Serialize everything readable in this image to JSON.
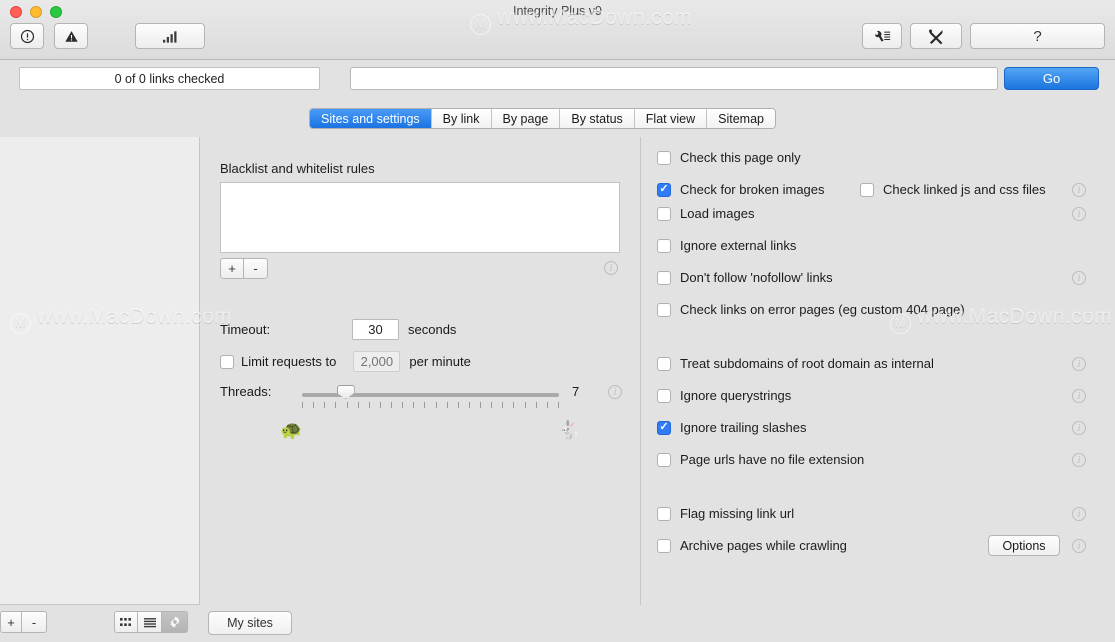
{
  "window": {
    "title": "Integrity Plus v9",
    "watermark": "www.MacDown.com",
    "watermark_mark": "M"
  },
  "toolbar": {
    "stop_icon": "exclamation-circle-icon",
    "warning_icon": "warning-triangle-icon",
    "chart_icon": "bar-chart-icon",
    "prefs_icon": "wrench-settings-icon",
    "tools_icon": "crossed-tools-icon",
    "help_label": "?"
  },
  "status": {
    "progress_text": "0 of 0 links checked",
    "url_value": "",
    "url_placeholder": "",
    "go_label": "Go"
  },
  "tabs": [
    {
      "label": "Sites and settings",
      "active": true
    },
    {
      "label": "By link",
      "active": false
    },
    {
      "label": "By page",
      "active": false
    },
    {
      "label": "By status",
      "active": false
    },
    {
      "label": "Flat view",
      "active": false
    },
    {
      "label": "Sitemap",
      "active": false
    }
  ],
  "sidebar": {
    "items": [],
    "add_label": "+",
    "remove_label": "-",
    "grid_icon": "grid-view-icon",
    "list_icon": "list-view-icon",
    "gear_icon": "gear-icon",
    "my_sites_label": "My sites"
  },
  "settings": {
    "rules_heading": "Blacklist and whitelist rules",
    "rules_value": "",
    "rules_add_label": "+",
    "rules_remove_label": "-",
    "timeout_label": "Timeout:",
    "timeout_value": "30",
    "timeout_suffix": "seconds",
    "limit_label": "Limit requests to",
    "limit_checked": false,
    "limit_placeholder": "2,000",
    "limit_suffix": "per minute",
    "threads_label": "Threads:",
    "threads_value": "7",
    "threads_min_icon": "turtle-icon",
    "threads_max_icon": "rabbit-icon",
    "threads_slider_percent": 17
  },
  "options": [
    {
      "label": "Check this page only",
      "checked": false,
      "info": false
    },
    {
      "label": "Check for broken images",
      "checked": true,
      "info": true
    },
    {
      "label": "Check linked js and css files",
      "checked": false,
      "info": false
    },
    {
      "label": "Load images",
      "checked": false,
      "info": true
    },
    {
      "label": "Ignore external links",
      "checked": false,
      "info": false
    },
    {
      "label": "Don't follow 'nofollow' links",
      "checked": false,
      "info": true
    },
    {
      "label": "Check links on error pages (eg custom 404 page)",
      "checked": false,
      "info": false
    },
    {
      "label": "Treat subdomains of root domain as internal",
      "checked": false,
      "info": true
    },
    {
      "label": "Ignore querystrings",
      "checked": false,
      "info": true
    },
    {
      "label": "Ignore trailing slashes",
      "checked": true,
      "info": true
    },
    {
      "label": "Page urls have no file extension",
      "checked": false,
      "info": true
    },
    {
      "label": "Flag missing link url",
      "checked": false,
      "info": true
    },
    {
      "label": "Archive pages while crawling",
      "checked": false,
      "info": true
    }
  ],
  "archive": {
    "options_label": "Options"
  },
  "colors": {
    "accent": "#2f7cf6",
    "window_bg": "#e2e2e2",
    "sidebar_bg": "#ededed"
  }
}
